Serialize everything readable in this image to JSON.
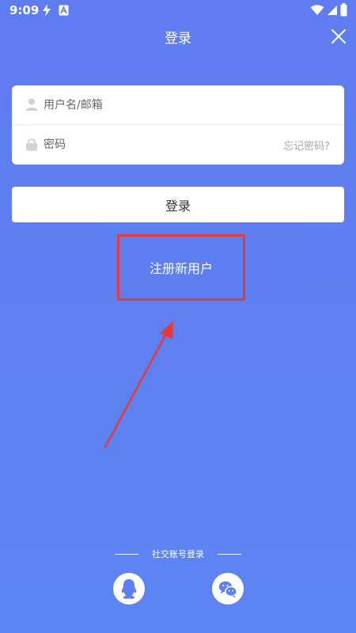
{
  "status_bar": {
    "time": "9:09"
  },
  "header": {
    "title": "登录",
    "close_icon": "close-icon"
  },
  "form": {
    "username_placeholder": "用户名/邮箱",
    "username_value": "",
    "password_placeholder": "密码",
    "password_value": "",
    "forgot_password": "忘记密码?"
  },
  "login_button": "登录",
  "register_link": "注册新用户",
  "social": {
    "label": "社交账号登录",
    "providers": [
      {
        "icon": "qq-icon"
      },
      {
        "icon": "wechat-icon"
      }
    ]
  },
  "colors": {
    "background": "#5f7cf0",
    "highlight_border": "#e53a3a",
    "arrow": "#e53a3a"
  }
}
